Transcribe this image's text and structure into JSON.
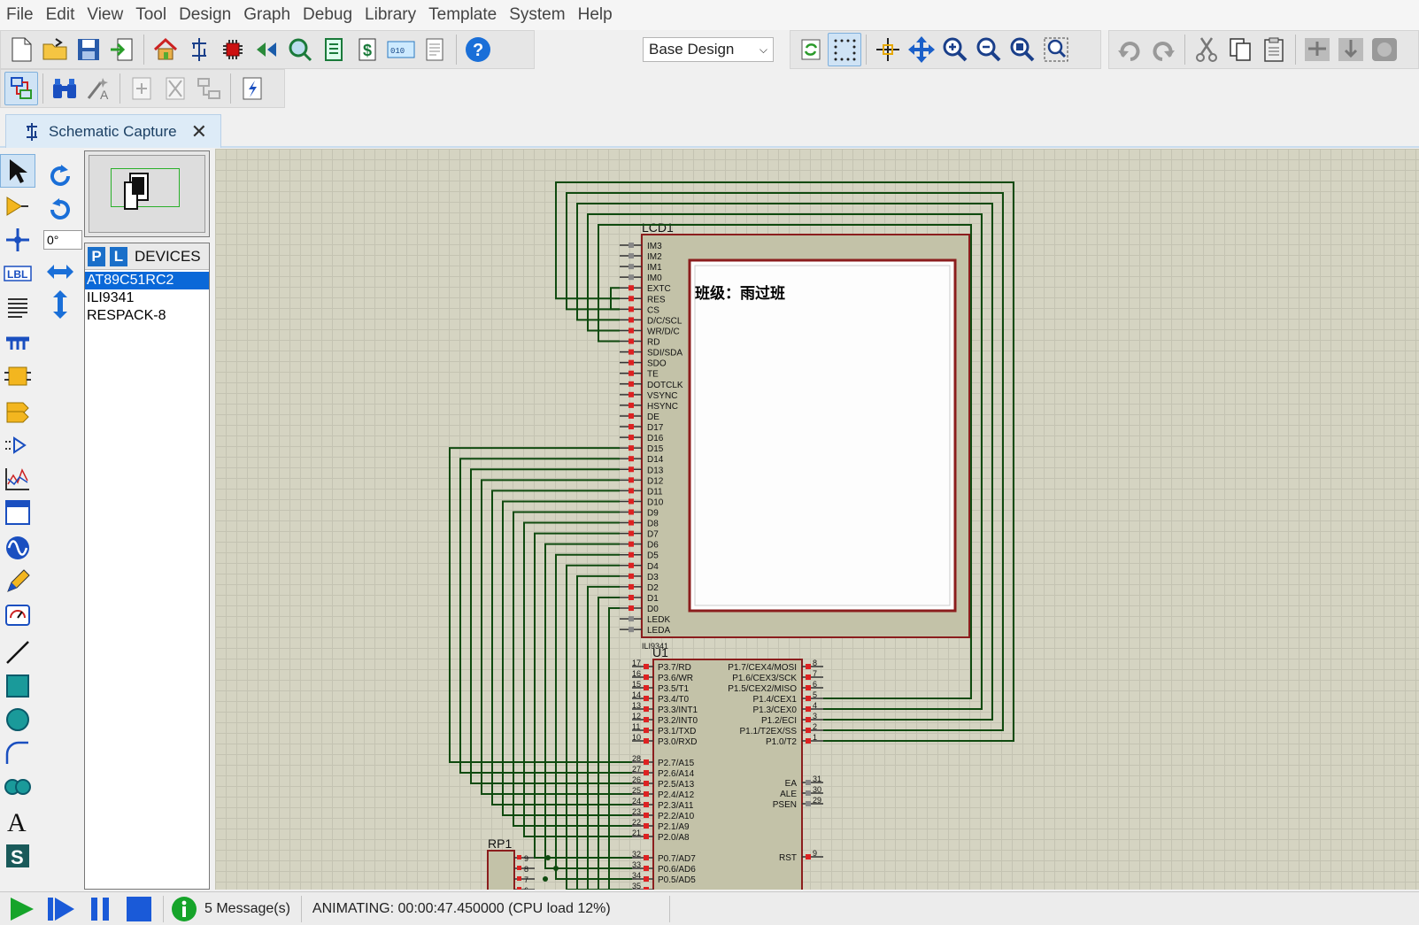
{
  "menu": [
    "File",
    "Edit",
    "View",
    "Tool",
    "Design",
    "Graph",
    "Debug",
    "Library",
    "Template",
    "System",
    "Help"
  ],
  "toolbar": {
    "design_variant": "Base Design"
  },
  "tabs": [
    {
      "label": "Schematic Capture",
      "close": "✕"
    }
  ],
  "rotation": {
    "angle": "0°"
  },
  "devices": {
    "p_label": "P",
    "l_label": "L",
    "title": "DEVICES",
    "items": [
      "AT89C51RC2",
      "ILI9341",
      "RESPACK-8"
    ],
    "selected": 0
  },
  "schematic": {
    "lcd": {
      "ref": "LCD1",
      "part": "ILI9341",
      "display_text": "班级：雨过班",
      "pins": [
        "IM3",
        "IM2",
        "IM1",
        "IM0",
        "EXTC",
        "RES",
        "CS",
        "D/C/SCL",
        "WR/D/C",
        "RD",
        "SDI/SDA",
        "SDO",
        "TE",
        "DOTCLK",
        "VSYNC",
        "HSYNC",
        "DE",
        "D17",
        "D16",
        "D15",
        "D14",
        "D13",
        "D12",
        "D11",
        "D10",
        "D9",
        "D8",
        "D7",
        "D6",
        "D5",
        "D4",
        "D3",
        "D2",
        "D1",
        "D0",
        "LEDK",
        "LEDA"
      ]
    },
    "mcu": {
      "ref": "U1",
      "left_pins": [
        [
          "17",
          "P3.7/RD"
        ],
        [
          "16",
          "P3.6/WR"
        ],
        [
          "15",
          "P3.5/T1"
        ],
        [
          "14",
          "P3.4/T0"
        ],
        [
          "13",
          "P3.3/INT1"
        ],
        [
          "12",
          "P3.2/INT0"
        ],
        [
          "11",
          "P3.1/TXD"
        ],
        [
          "10",
          "P3.0/RXD"
        ],
        [
          "28",
          "P2.7/A15"
        ],
        [
          "27",
          "P2.6/A14"
        ],
        [
          "26",
          "P2.5/A13"
        ],
        [
          "25",
          "P2.4/A12"
        ],
        [
          "24",
          "P2.3/A11"
        ],
        [
          "23",
          "P2.2/A10"
        ],
        [
          "22",
          "P2.1/A9"
        ],
        [
          "21",
          "P2.0/A8"
        ],
        [
          "32",
          "P0.7/AD7"
        ],
        [
          "33",
          "P0.6/AD6"
        ],
        [
          "34",
          "P0.5/AD5"
        ],
        [
          "35",
          ""
        ]
      ],
      "right_pins": [
        [
          "8",
          "P1.7/CEX4/MOSI"
        ],
        [
          "7",
          "P1.6/CEX3/SCK"
        ],
        [
          "6",
          "P1.5/CEX2/MISO"
        ],
        [
          "5",
          "P1.4/CEX1"
        ],
        [
          "4",
          "P1.3/CEX0"
        ],
        [
          "3",
          "P1.2/ECI"
        ],
        [
          "2",
          "P1.1/T2EX/SS"
        ],
        [
          "1",
          "P1.0/T2"
        ],
        [
          "31",
          "EA"
        ],
        [
          "30",
          "ALE"
        ],
        [
          "29",
          "PSEN"
        ],
        [
          "9",
          "RST"
        ]
      ]
    },
    "rp": {
      "ref": "RP1",
      "pins": [
        "9",
        "8",
        "7",
        "6"
      ]
    }
  },
  "status": {
    "messages": "5 Message(s)",
    "animating": "ANIMATING: 00:00:47.450000 (CPU load 12%)"
  }
}
